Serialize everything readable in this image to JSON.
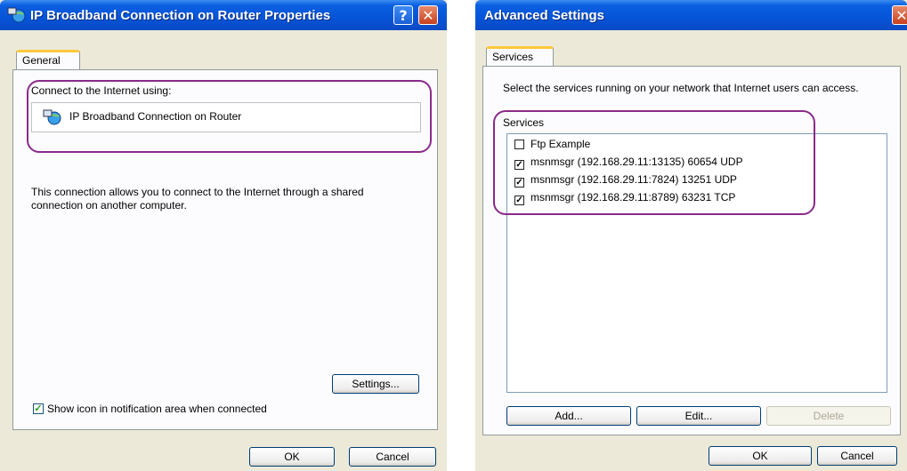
{
  "left_dialog": {
    "title": "IP Broadband Connection on Router Properties",
    "help_glyph": "?",
    "close_glyph": "✕",
    "tab_general": "General",
    "connect_label": "Connect to the Internet using:",
    "connection_name": "IP Broadband Connection on Router",
    "description": "This connection allows you to connect to the Internet through a shared connection on another computer.",
    "settings_button": "Settings...",
    "show_icon_checkbox": {
      "label": "Show icon in notification area when connected",
      "checked": true
    },
    "ok_button": "OK",
    "cancel_button": "Cancel"
  },
  "right_dialog": {
    "title": "Advanced Settings",
    "close_glyph": "✕",
    "tab_services": "Services",
    "instructions": "Select the services running on your network that Internet users can access.",
    "services_label": "Services",
    "services": [
      {
        "label": "Ftp Example",
        "checked": false
      },
      {
        "label": "msnmsgr (192.168.29.11:13135) 60654 UDP",
        "checked": true
      },
      {
        "label": "msnmsgr (192.168.29.11:7824) 13251 UDP",
        "checked": true
      },
      {
        "label": "msnmsgr (192.168.29.11:8789) 63231 TCP",
        "checked": true
      }
    ],
    "add_button": "Add...",
    "edit_button": "Edit...",
    "delete_button": "Delete",
    "ok_button": "OK",
    "cancel_button": "Cancel"
  },
  "colors": {
    "titlebar": "#0654d8",
    "dialog_bg": "#ece9d8",
    "highlight": "#8a2a8a",
    "tab_accent": "#ffc83c"
  }
}
